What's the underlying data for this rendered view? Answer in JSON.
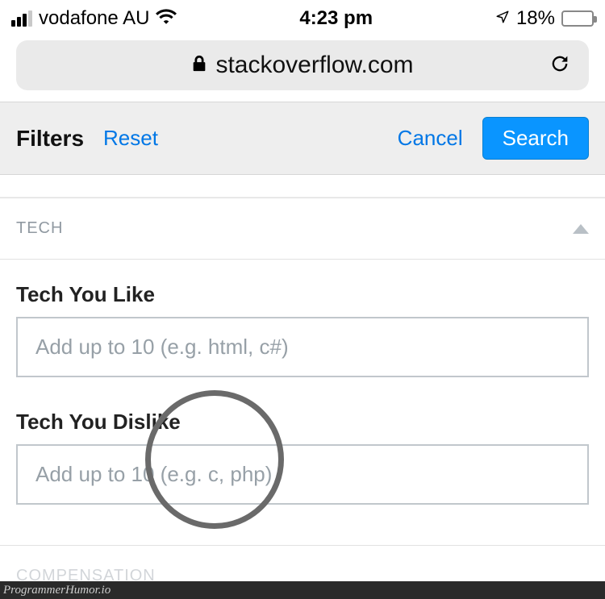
{
  "status": {
    "carrier": "vodafone AU",
    "time": "4:23 pm",
    "battery_pct": "18%"
  },
  "url_bar": {
    "domain": "stackoverflow.com"
  },
  "filters_bar": {
    "title": "Filters",
    "reset": "Reset",
    "cancel": "Cancel",
    "search": "Search"
  },
  "sections": {
    "tech": {
      "header": "TECH",
      "like_label": "Tech You Like",
      "like_placeholder": "Add up to 10 (e.g. html, c#)",
      "dislike_label": "Tech You Dislike",
      "dislike_placeholder": "Add up to 10 (e.g. c, php)"
    },
    "compensation": {
      "header": "COMPENSATION"
    }
  },
  "watermark": "ProgrammerHumor.io"
}
